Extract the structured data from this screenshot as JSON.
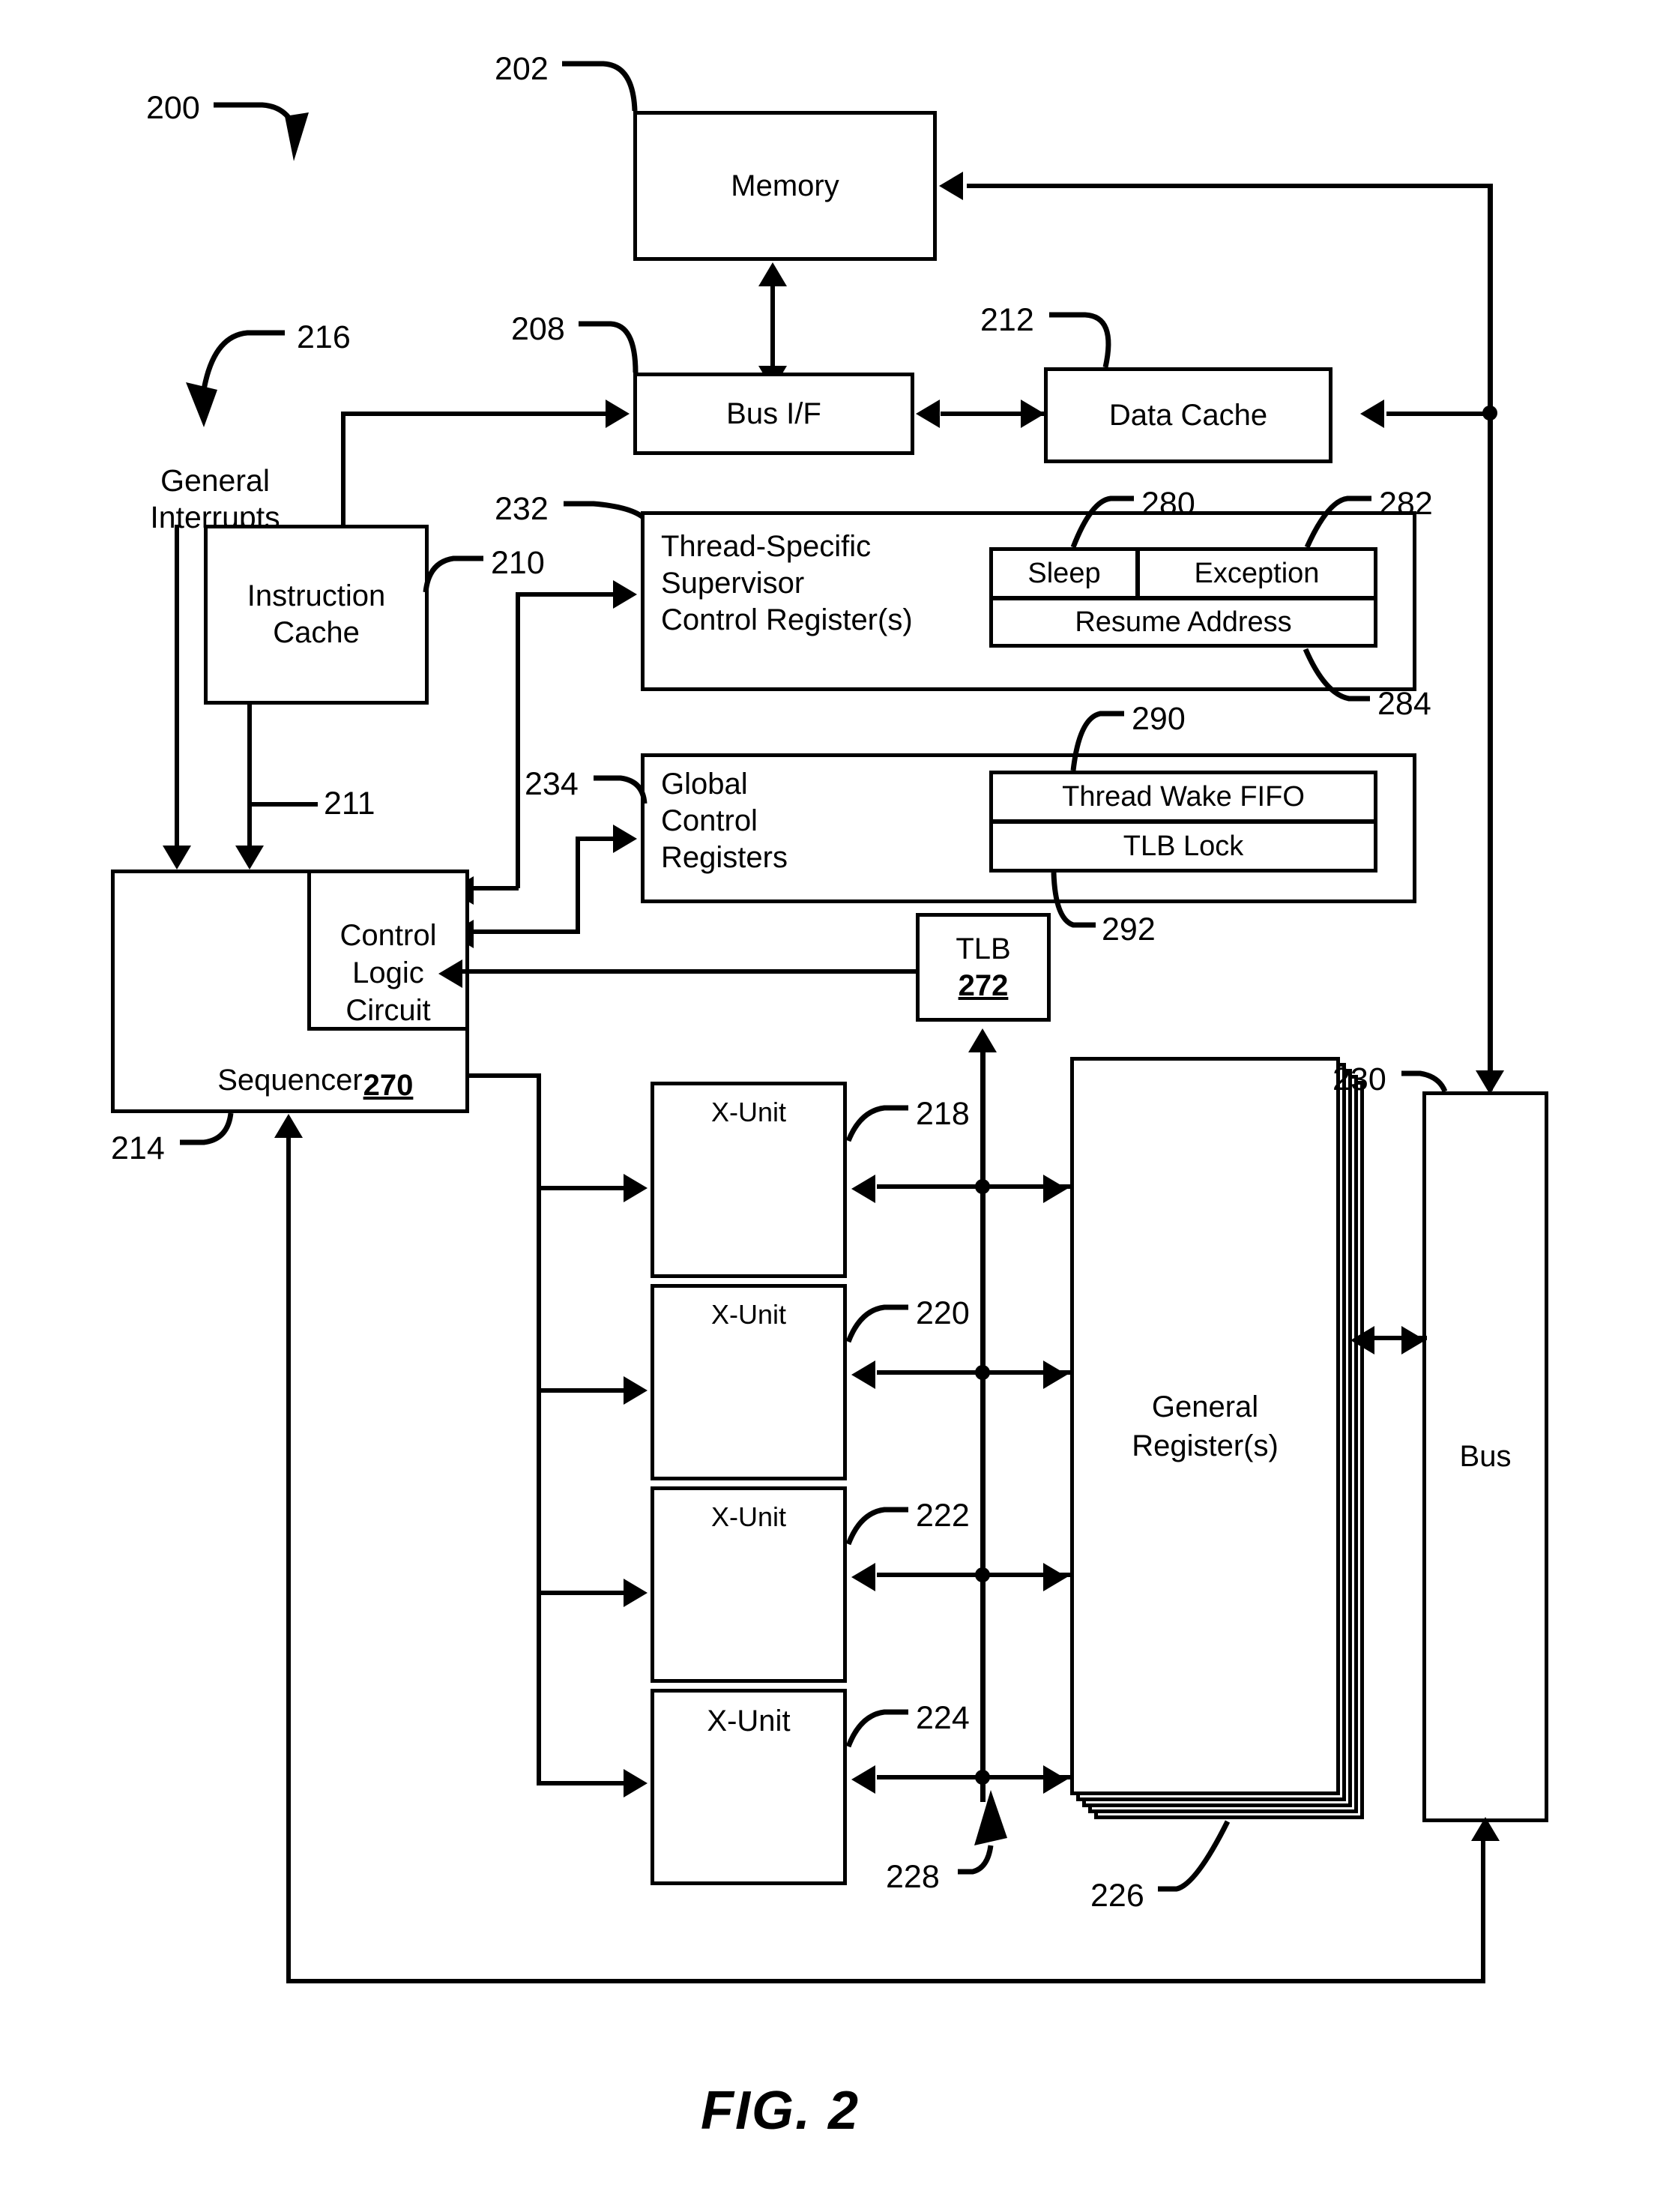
{
  "figure": {
    "caption": "FIG. 2",
    "system_ref": "200"
  },
  "blocks": {
    "memory": {
      "label": "Memory",
      "ref": "202"
    },
    "bus_if": {
      "label": "Bus I/F",
      "ref": "208"
    },
    "data_cache": {
      "label": "Data Cache",
      "ref": "212"
    },
    "instruction_cache": {
      "label": "Instruction\nCache",
      "ref": "210"
    },
    "thread_specific_regs": {
      "label": "Thread-Specific\nSupervisor\nControl Register(s)",
      "ref": "232"
    },
    "global_control_regs": {
      "label": "Global\nControl\nRegisters",
      "ref": "234"
    },
    "sequencer": {
      "label": "Sequencer",
      "ref": "214"
    },
    "control_logic": {
      "label": "Control\nLogic\nCircuit",
      "ref": "270"
    },
    "tlb": {
      "label": "TLB",
      "ref": "272"
    },
    "general_registers": {
      "label": "General\nRegister(s)",
      "ref": "226"
    },
    "bus": {
      "label": "Bus",
      "ref": "230"
    },
    "sleep": {
      "label": "Sleep",
      "ref": "280"
    },
    "exception": {
      "label": "Exception",
      "ref": "282"
    },
    "resume_address": {
      "label": "Resume Address",
      "ref": "284"
    },
    "thread_wake_fifo": {
      "label": "Thread Wake FIFO",
      "ref": "290"
    },
    "tlb_lock": {
      "label": "TLB Lock",
      "ref": "292"
    }
  },
  "xunits": [
    {
      "label": "X-Unit",
      "ref": "218"
    },
    {
      "label": "X-Unit",
      "ref": "220"
    },
    {
      "label": "X-Unit",
      "ref": "222"
    },
    {
      "label": "X-Unit",
      "ref": "224"
    }
  ],
  "signals": {
    "general_interrupts": "General\nInterrupts",
    "interrupts_ref": "216",
    "icache_out_ref": "211",
    "xunit_bus_ref": "228"
  }
}
